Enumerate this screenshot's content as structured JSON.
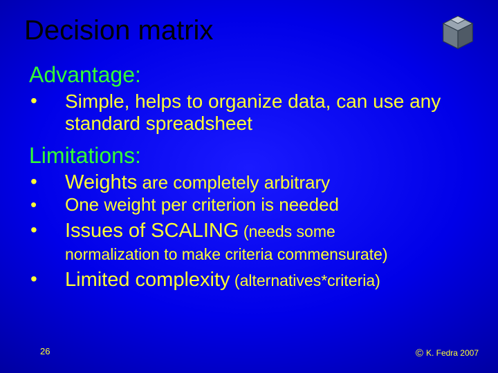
{
  "title": "Decision matrix",
  "sections": {
    "advantage": {
      "heading": "Advantage:",
      "items": [
        {
          "text": "Simple, helps to organize data, can use any standard spreadsheet"
        }
      ]
    },
    "limitations": {
      "heading": "Limitations:",
      "items": [
        {
          "prefix": "Weights",
          "rest": " are completely arbitrary"
        },
        {
          "text": "One weight per criterion is needed"
        },
        {
          "prefix": "Issues of SCALING",
          "paren": " (needs some ",
          "cont": "normalization to make criteria commensurate)"
        },
        {
          "prefix": "Limited complexity",
          "paren": " (alternatives*criteria)"
        }
      ]
    }
  },
  "page_number": "26",
  "copyright_symbol": "©",
  "copyright_text": "K. Fedra 2007",
  "logo_name": "cube-logo"
}
